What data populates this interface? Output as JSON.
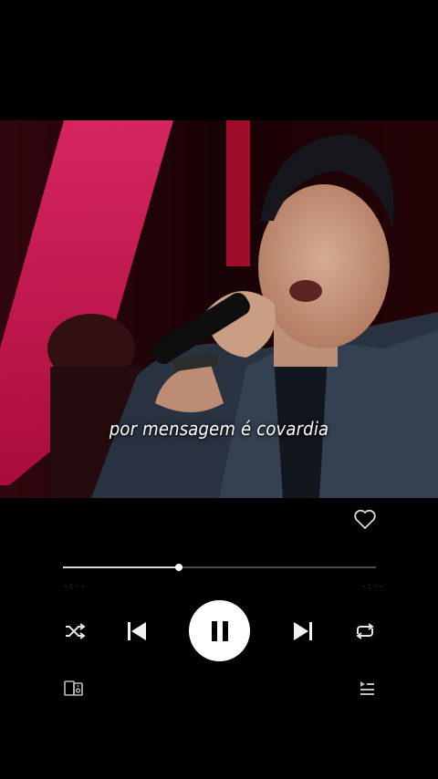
{
  "video": {
    "lyric": "por mensagem é covardia"
  },
  "player": {
    "liked": false,
    "progress_fraction": 0.37,
    "time_elapsed": "-:--",
    "time_total": "-:--",
    "state": "playing",
    "icons": {
      "like": "heart-outline-icon",
      "shuffle": "shuffle-icon",
      "previous": "skip-previous-icon",
      "pause": "pause-icon",
      "next": "skip-next-icon",
      "repeat": "repeat-icon",
      "devices": "devices-icon",
      "queue": "queue-icon"
    }
  },
  "colors": {
    "background": "#000000",
    "accent_stage": "#e8145a",
    "control": "#ffffff"
  }
}
